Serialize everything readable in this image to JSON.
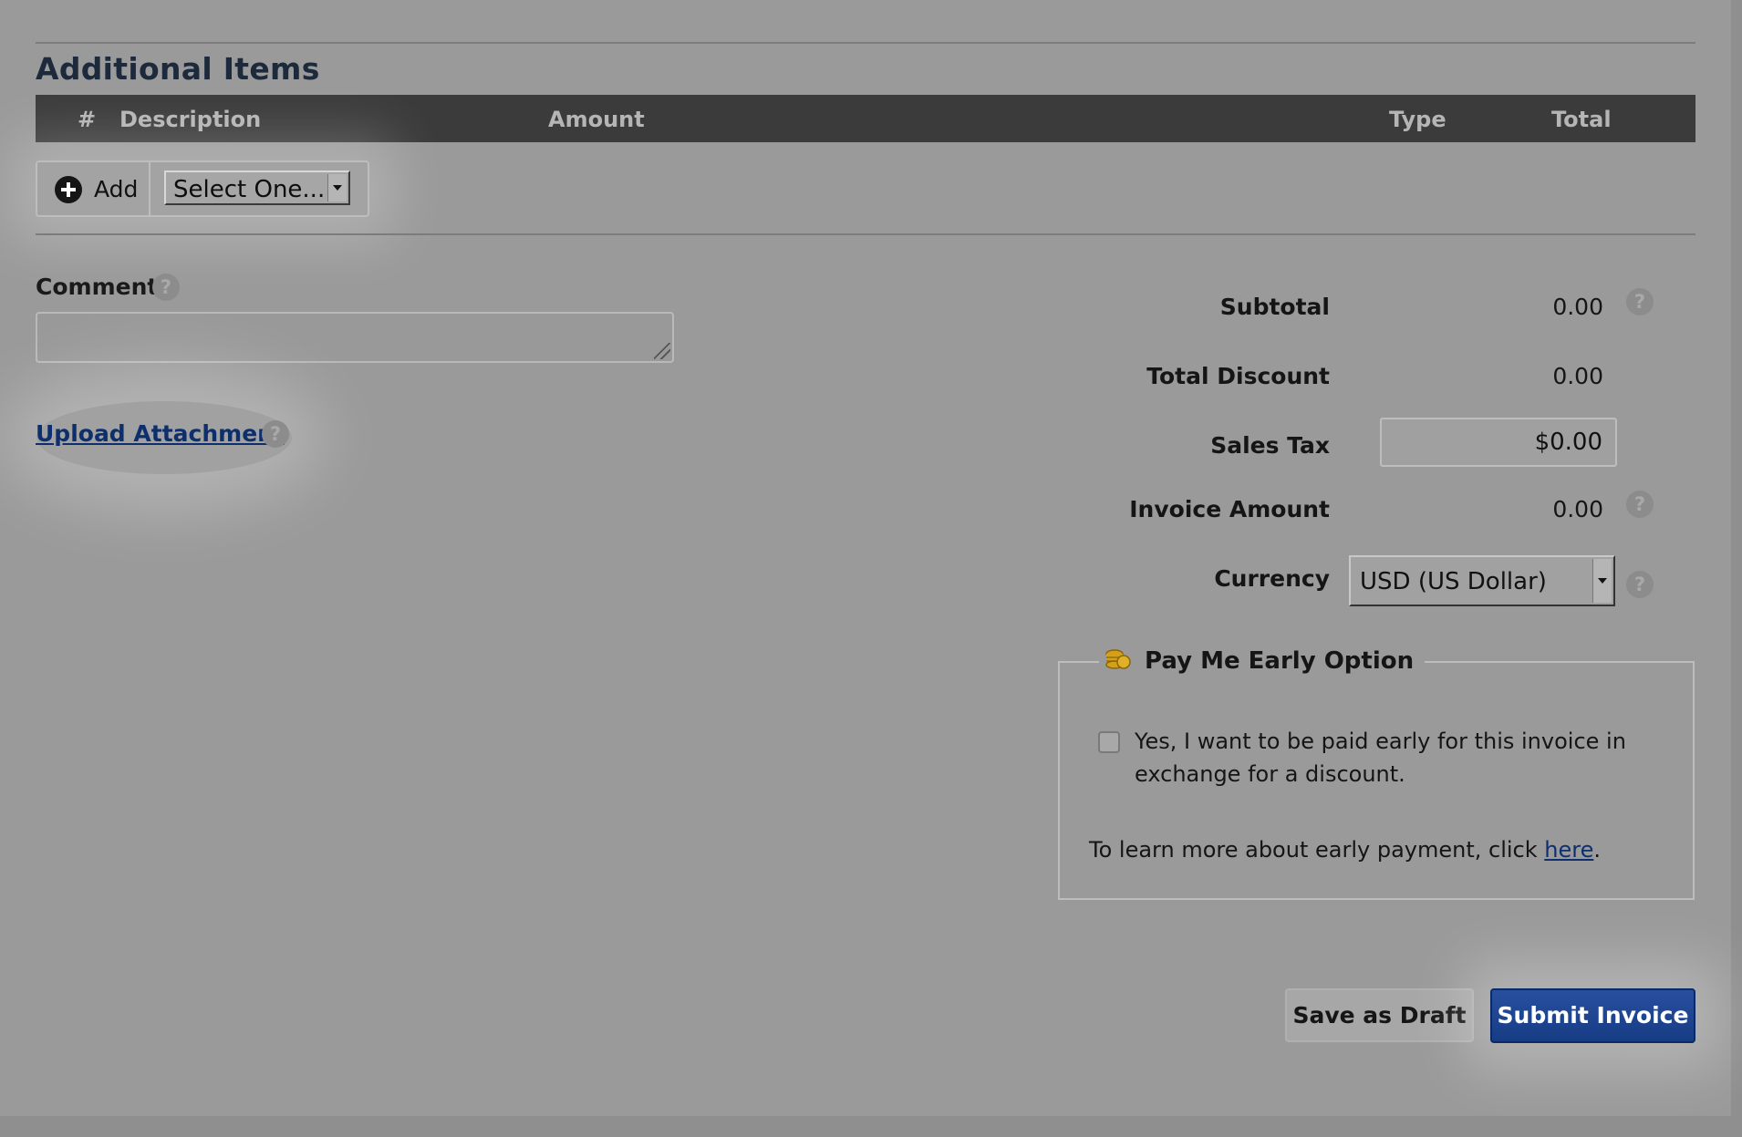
{
  "section": {
    "title": "Additional Items"
  },
  "table": {
    "columns": [
      "#",
      "Description",
      "Amount",
      "Type",
      "Total"
    ]
  },
  "add_row": {
    "add_label": "Add",
    "select_value": "Select One..."
  },
  "comment": {
    "label": "Comment",
    "value": ""
  },
  "upload": {
    "label": "Upload Attachment"
  },
  "totals": {
    "subtotal_label": "Subtotal",
    "subtotal_value": "0.00",
    "discount_label": "Total Discount",
    "discount_value": "0.00",
    "tax_label": "Sales Tax",
    "tax_value": "$0.00",
    "invoice_label": "Invoice Amount",
    "invoice_value": "0.00",
    "currency_label": "Currency",
    "currency_value": "USD (US Dollar)"
  },
  "pay_early": {
    "title": "Pay Me Early Option",
    "checkbox_text": "Yes, I want to be paid early for this invoice in exchange for a discount.",
    "learn_prefix": "To learn more about early payment, click ",
    "learn_link": "here",
    "learn_suffix": "."
  },
  "actions": {
    "draft_label": "Save as Draft",
    "submit_label": "Submit Invoice"
  },
  "icons": {
    "help": "question-mark",
    "add": "plus-circle",
    "coins": "coins",
    "select": "chevron-down"
  },
  "colors": {
    "link": "#0e2f6e",
    "submit_button": "#1b438f",
    "table_header": "#3b3b3b",
    "title": "#1c2a3c"
  }
}
